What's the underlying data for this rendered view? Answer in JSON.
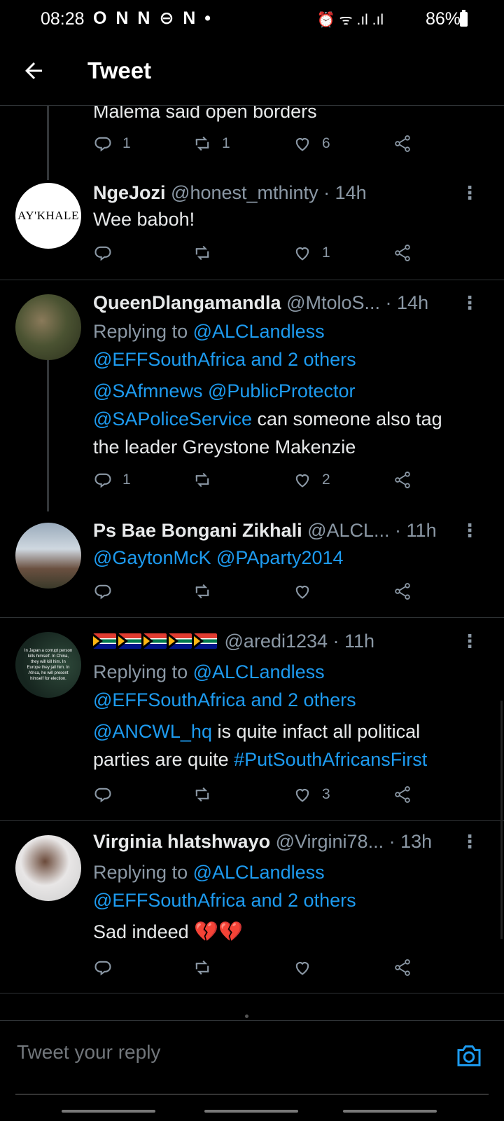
{
  "status_bar": {
    "time": "08:28",
    "notif_icons": "O N N ⊖ N •",
    "sys_icons": "⏰ ᯤ .ıl .ıl",
    "battery": "86%"
  },
  "app_bar": {
    "title": "Tweet"
  },
  "tweets": [
    {
      "text": "Malema said open borders",
      "replies": "1",
      "retweets": "1",
      "likes": "6"
    },
    {
      "avatar_text": "AY'KHALE",
      "name": "NgeJozi",
      "handle": "@honest_mthinty",
      "time": " · 14h",
      "text": "Wee baboh!",
      "replies": "",
      "retweets": "",
      "likes": "1"
    },
    {
      "name": "QueenDlangamandla",
      "handle": "@MtoloS...",
      "time": " · 14h",
      "reply_prefix": "Replying to ",
      "reply_user": "@ALCLandless",
      "reply_line2": "@EFFSouthAfrica and 2 others",
      "mention1": "@SAfmnews",
      "mention2": "@PublicProtector",
      "mention3": "@SAPoliceService",
      "text_a": " can someone also tag",
      "text_b": "the leader Greystone Makenzie",
      "replies": "1",
      "retweets": "",
      "likes": "2"
    },
    {
      "name": "Ps  Bae Bongani Zikhali",
      "handle": "@ALCL...",
      "time": " · 11h",
      "mention1": "@GaytonMcK",
      "mention2": "@PAparty2014",
      "replies": "",
      "retweets": "",
      "likes": ""
    },
    {
      "avatar_text": "In Japan a corrupt person kills himself. In China, they will kill him. In Europe they jail him. In Africa, he will present himself for election.",
      "handle": "@aredi1234",
      "time": " · 11h",
      "reply_prefix": "Replying to ",
      "reply_user": "@ALCLandless",
      "reply_line2": "@EFFSouthAfrica and 2 others",
      "mention1": "@ANCWL_hq",
      "text_a": " is quite infact all political",
      "text_b": "parties are quite ",
      "hashtag": "#PutSouthAfricansFirst",
      "replies": "",
      "retweets": "",
      "likes": "3"
    },
    {
      "name": "Virginia hlatshwayo",
      "handle": "@Virgini78...",
      "time": " · 13h",
      "reply_prefix": "Replying to ",
      "reply_user": "@ALCLandless",
      "reply_line2": "@EFFSouthAfrica and 2 others",
      "text": "Sad indeed ",
      "emoji": "💔💔",
      "replies": "",
      "retweets": "",
      "likes": ""
    }
  ],
  "reply_bar": {
    "placeholder": "Tweet your reply"
  },
  "colors": {
    "link": "#1d9bf0",
    "muted": "#8b98a5",
    "background": "#000000"
  }
}
